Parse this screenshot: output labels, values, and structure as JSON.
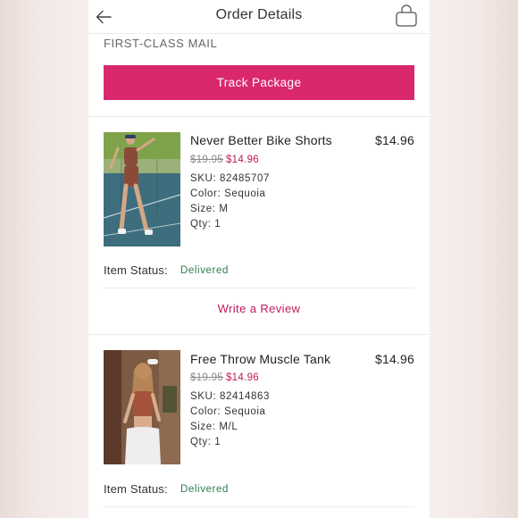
{
  "header": {
    "title": "Order Details",
    "back_icon": "arrow-left-icon",
    "bag_icon": "shopping-bag-icon"
  },
  "shipping": {
    "carrier": "FIRST-CLASS MAIL",
    "track_label": "Track Package"
  },
  "colors": {
    "accent": "#d9286e",
    "sale_price": "#c2185b",
    "delivered": "#2e7d4f"
  },
  "items": [
    {
      "name": "Never Better Bike Shorts",
      "price": "$14.96",
      "original_price": "$19.95",
      "sale_price": "$14.96",
      "sku": "SKU: 82485707",
      "color": "Color: Sequoia",
      "size": "Size: M",
      "qty": "Qty: 1",
      "status_label": "Item Status:",
      "status": "Delivered",
      "review_label": "Write a Review"
    },
    {
      "name": "Free Throw Muscle Tank",
      "price": "$14.96",
      "original_price": "$19.95",
      "sale_price": "$14.96",
      "sku": "SKU: 82414863",
      "color": "Color: Sequoia",
      "size": "Size: M/L",
      "qty": "Qty: 1",
      "status_label": "Item Status:",
      "status": "Delivered"
    }
  ]
}
